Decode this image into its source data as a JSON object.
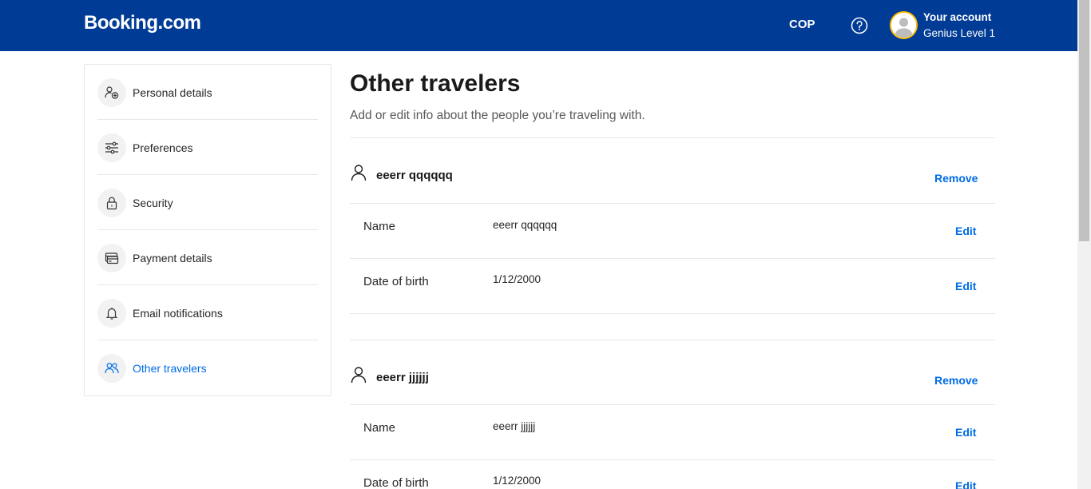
{
  "header": {
    "logo": "Booking.com",
    "currency": "COP",
    "account_title": "Your account",
    "account_level": "Genius Level 1"
  },
  "sidebar": {
    "items": [
      {
        "label": "Personal details",
        "icon": "person-plus-icon"
      },
      {
        "label": "Preferences",
        "icon": "sliders-icon"
      },
      {
        "label": "Security",
        "icon": "lock-icon"
      },
      {
        "label": "Payment details",
        "icon": "card-icon"
      },
      {
        "label": "Email notifications",
        "icon": "bell-icon"
      },
      {
        "label": "Other travelers",
        "icon": "people-icon",
        "active": true
      }
    ]
  },
  "main": {
    "title": "Other travelers",
    "subtitle": "Add or edit info about the people you’re traveling with.",
    "travelers": [
      {
        "name": "eeerr qqqqqq",
        "remove_label": "Remove",
        "rows": [
          {
            "label": "Name",
            "value": "eeerr qqqqqq",
            "action": "Edit"
          },
          {
            "label": "Date of birth",
            "value": "1/12/2000",
            "action": "Edit"
          }
        ]
      },
      {
        "name": "eeerr jjjjjj",
        "remove_label": "Remove",
        "rows": [
          {
            "label": "Name",
            "value": "eeerr jjjjjj",
            "action": "Edit"
          },
          {
            "label": "Date of birth",
            "value": "1/12/2000",
            "action": "Edit"
          }
        ]
      }
    ]
  },
  "colors": {
    "brand": "#003b95",
    "link": "#006ce4",
    "genius_ring": "#febb02"
  }
}
